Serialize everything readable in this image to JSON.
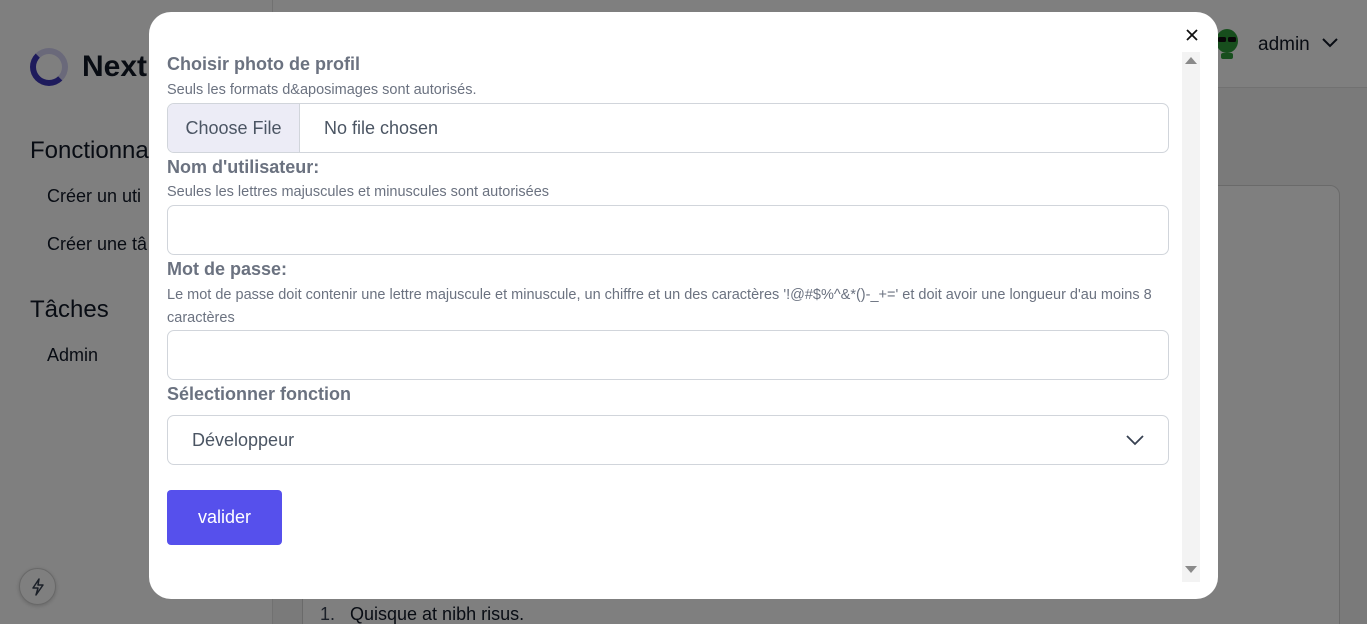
{
  "app": {
    "brand_name": "Next",
    "sidebar": {
      "sections": [
        {
          "heading": "Fonctionna",
          "items": [
            "Créer un uti",
            "Créer une tâ"
          ]
        },
        {
          "heading": "Tâches",
          "items": [
            "Admin"
          ]
        }
      ]
    },
    "header": {
      "user_name": "admin"
    },
    "content": {
      "list_number": "1.",
      "list_text": "Quisque at nibh risus."
    }
  },
  "modal": {
    "photo": {
      "label": "Choisir photo de profil",
      "hint": "Seuls les formats d&aposimages sont autorisés.",
      "button_label": "Choose File",
      "status": "No file chosen"
    },
    "username": {
      "label": "Nom d'utilisateur:",
      "hint": "Seules les lettres majuscules et minuscules sont autorisées",
      "value": ""
    },
    "password": {
      "label": "Mot de passe:",
      "hint": "Le mot de passe doit contenir une lettre majuscule et minuscule, un chiffre et un des caractères '!@#$%^&*()-_+=' et doit avoir une longueur d'au moins 8 caractères",
      "value": ""
    },
    "role": {
      "label": "Sélectionner fonction",
      "selected": "Développeur"
    },
    "submit_label": "valider"
  },
  "icons": {
    "close": "close-icon",
    "select_chevron": "chevron-down-icon",
    "user_chevron": "chevron-down-icon",
    "avatar": "alien-avatar",
    "bolt": "lightning-icon",
    "logo": "ring-logo"
  },
  "colors": {
    "accent": "#5650ec",
    "logo": "#3d36b8",
    "overlay": "rgba(0,0,0,0.5)",
    "label": "#6b7280"
  }
}
